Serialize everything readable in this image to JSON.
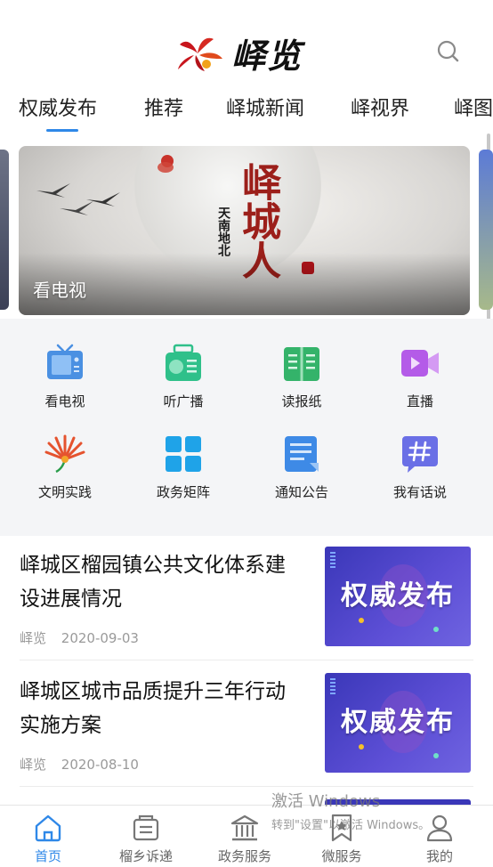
{
  "header": {
    "logo_text": "峄览",
    "search_icon": "search-icon"
  },
  "tabs": [
    {
      "label": "权威发布",
      "active": true
    },
    {
      "label": "推荐"
    },
    {
      "label": "峄城新闻"
    },
    {
      "label": "峄视界"
    },
    {
      "label": "峄图"
    }
  ],
  "banner": {
    "title": "看电视",
    "art_main": "峄城人",
    "art_side": "天南地北"
  },
  "grid": [
    {
      "label": "看电视",
      "icon": "tv-icon",
      "color": "#4a90e2"
    },
    {
      "label": "听广播",
      "icon": "radio-icon",
      "color": "#2fc08a"
    },
    {
      "label": "读报纸",
      "icon": "newspaper-icon",
      "color": "#34b36a"
    },
    {
      "label": "直播",
      "icon": "video-icon",
      "color": "#b45be8"
    },
    {
      "label": "文明实践",
      "icon": "civilization-icon",
      "color": "#e5532f"
    },
    {
      "label": "政务矩阵",
      "icon": "matrix-icon",
      "color": "#1fa3e8"
    },
    {
      "label": "通知公告",
      "icon": "notice-icon",
      "color": "#3e8ae6"
    },
    {
      "label": "我有话说",
      "icon": "hashtag-icon",
      "color": "#6a6fe6"
    }
  ],
  "news": [
    {
      "title": "峄城区榴园镇公共文化体系建设进展情况",
      "source": "峄览",
      "date": "2020-09-03",
      "thumb_text": "权威发布"
    },
    {
      "title": "峄城区城市品质提升三年行动实施方案",
      "source": "峄览",
      "date": "2020-08-10",
      "thumb_text": "权威发布"
    }
  ],
  "bottom_nav": [
    {
      "label": "首页",
      "icon": "home-icon",
      "active": true
    },
    {
      "label": "榴乡诉递",
      "icon": "inbox-icon"
    },
    {
      "label": "政务服务",
      "icon": "government-icon"
    },
    {
      "label": "微服务",
      "icon": "bookmark-star-icon"
    },
    {
      "label": "我的",
      "icon": "user-icon"
    }
  ],
  "watermark": {
    "title": "激活 Windows",
    "subtitle": "转到\"设置\"以激活 Windows。"
  },
  "colors": {
    "accent": "#2f88e8",
    "thumb_bg": "#3a37b8"
  }
}
